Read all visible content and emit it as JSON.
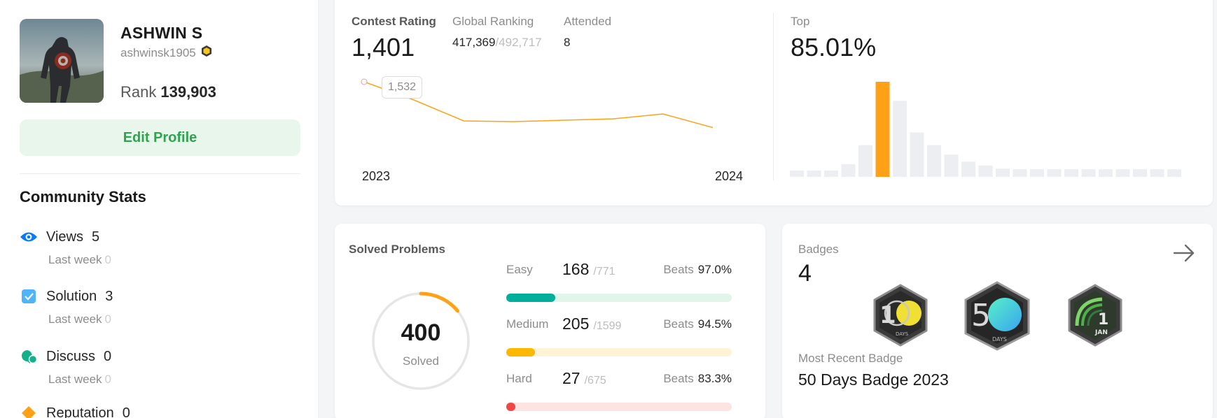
{
  "profile": {
    "name": "ASHWIN S",
    "handle": "ashwinsk1905",
    "rank_label": "Rank",
    "rank_value": "139,903",
    "edit_label": "Edit Profile"
  },
  "community": {
    "title": "Community Stats",
    "stats": [
      {
        "label": "Views",
        "value": "5",
        "last_week_label": "Last week",
        "last_week_value": "0",
        "icon": "eye-icon"
      },
      {
        "label": "Solution",
        "value": "3",
        "last_week_label": "Last week",
        "last_week_value": "0",
        "icon": "check-square-icon"
      },
      {
        "label": "Discuss",
        "value": "0",
        "last_week_label": "Last week",
        "last_week_value": "0",
        "icon": "discuss-icon"
      },
      {
        "label": "Reputation",
        "value": "0",
        "icon": "reputation-icon"
      }
    ]
  },
  "contest": {
    "rating_label": "Contest Rating",
    "rating_value": "1,401",
    "global_label": "Global Ranking",
    "global_value": "417,369",
    "global_total": "/492,717",
    "attended_label": "Attended",
    "attended_value": "8",
    "tooltip": "1,532",
    "year_start": "2023",
    "year_end": "2024",
    "top_label": "Top",
    "top_value": "85.01%",
    "accent": "#ffa116"
  },
  "chart_data": [
    {
      "type": "line",
      "x": [
        1,
        2,
        3,
        4,
        5,
        6,
        7,
        8
      ],
      "values": [
        1532,
        1480,
        1420,
        1418,
        1422,
        1426,
        1440,
        1401
      ],
      "xlabel": "",
      "ylabel": ""
    },
    {
      "type": "bar",
      "values": [
        1,
        1,
        1,
        2,
        5,
        15,
        12,
        7,
        5,
        3.5,
        2.4,
        1.8,
        1.3,
        1.2,
        1.2,
        1.2,
        1.2,
        1.2,
        1.2,
        1.2,
        1.2,
        1.2,
        1.2
      ],
      "highlight_index": 5,
      "highlight_color": "#ffa116",
      "color": "#eceef2"
    }
  ],
  "solved": {
    "title": "Solved Problems",
    "total": "400",
    "total_label": "Solved",
    "ring_fraction": 0.14,
    "difficulties": [
      {
        "name": "Easy",
        "count": "168",
        "total": "/771",
        "beats_label": "Beats",
        "beats": "97.0%",
        "fraction": 0.218,
        "color": "#00af9b",
        "track": "#e2f5ea"
      },
      {
        "name": "Medium",
        "count": "205",
        "total": "/1599",
        "beats_label": "Beats",
        "beats": "94.5%",
        "fraction": 0.128,
        "color": "#ffb800",
        "track": "#fef3d6"
      },
      {
        "name": "Hard",
        "count": "27",
        "total": "/675",
        "beats_label": "Beats",
        "beats": "83.3%",
        "fraction": 0.04,
        "color": "#ef4743",
        "track": "#fde3e2"
      }
    ]
  },
  "badges": {
    "title": "Badges",
    "count": "4",
    "recent_label": "Most Recent Badge",
    "recent_value": "50 Days Badge 2023",
    "badge_list": [
      {
        "icon": "badge-100-days-icon",
        "number": "100",
        "caption": "DAYS"
      },
      {
        "icon": "badge-50-days-icon",
        "number": "50",
        "caption": "DAYS"
      },
      {
        "icon": "badge-jan-icon",
        "number": "1",
        "caption": "JAN"
      }
    ]
  }
}
